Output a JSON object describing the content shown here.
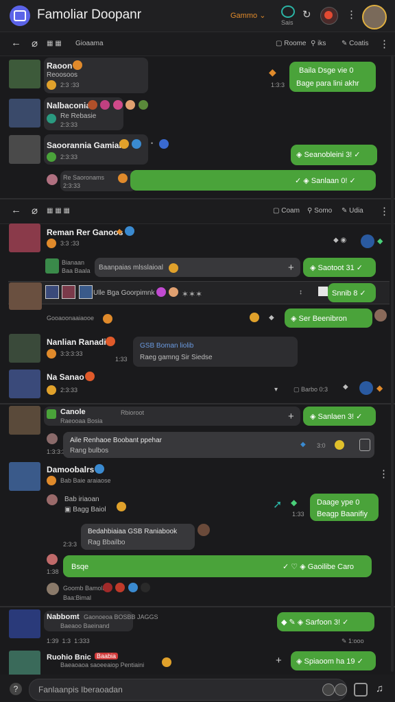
{
  "app": {
    "title": "Famoliar Doopanr",
    "account_label": "Gammo",
    "status_label": "Sais"
  },
  "subbar1": {
    "left_label": "Gioaama",
    "action1": "Roome",
    "action2": "iks",
    "action3": "Coatis"
  },
  "subbar2": {
    "action1": "Coam",
    "action2": "Somo",
    "action3": "Udia"
  },
  "messages": [
    {
      "name": "Raoon",
      "sub": "Reoosoos",
      "time": "2:3 :33",
      "right_time": "1:3:3",
      "reply_line1": "Baila Dsge vie 0",
      "reply_line2": "Bage para lini akhr"
    },
    {
      "name": "Nalbaconia",
      "sub": "Re Rebasie",
      "time": "2:3:33"
    },
    {
      "name": "Saoorannia Gamiak",
      "time": "2:3:33",
      "reply": "Seanobleini 3!",
      "bar_label": "Sanlaan 0!",
      "bar_sub": "Re Saoronams",
      "bar_time": "2:3:33"
    },
    {
      "name": "Reman Rer Ganoos",
      "time": "3:3 :33",
      "attach_label": "Bianaan",
      "attach_sub": "Baa Baala",
      "preview": "Baanpaias mlsslaioal",
      "reply": "Saotoot 31"
    },
    {
      "strip_text": "Ulle Bga Goorpimnk",
      "reply": "Snnib 8",
      "sub": "Gooaoonaaiaooe"
    },
    {
      "reply": "Ser Beenibron"
    },
    {
      "name": "Nanlian Ranadia",
      "time": "3:3:3:33",
      "mid_time": "1:33",
      "bubble_title": "GSB Boman liolib",
      "bubble_line": "Raeg gamng Sir Siedse"
    },
    {
      "name": "Na Sanao",
      "time": "2:3:33",
      "status": "Barbo 0:3"
    },
    {
      "name": "Canole",
      "sub": "Raeooaa Bosia",
      "right_note": "Rbioroot",
      "reply": "Sanlaen 3!"
    },
    {
      "line1": "Aile Renhaoe Boobant ppehar",
      "line2": "Rang bulbos",
      "time": "1:3:3:33",
      "badge": "3:0"
    },
    {
      "name": "Damoobalrs",
      "sub": "Bab Baie araiaose"
    },
    {
      "line1": "Bab iriaoan",
      "line2": "Bagg Baiol",
      "time": "1:33",
      "reply_line1": "Daage ype 0",
      "reply_line2": "Beagp Baanifiy"
    },
    {
      "line1": "Bedahbiaiaa GSB Raniabook",
      "line2": "Rag Bbailbo",
      "time": "2:3:3"
    },
    {
      "text": "Bsqe",
      "reply": "Gaoilibe Caro",
      "time": "1:38"
    },
    {
      "line1": "Goomb Bamolioo",
      "line2": "Baa:Bimal"
    },
    {
      "name": "Nabbomt",
      "sub_colored": "Gaonoeoa BOSBB JAGGS",
      "sub": "Baeaoo Baeinand",
      "reply": "Sarfoon 3!"
    },
    {
      "time1": "1:39",
      "time2": "1:3",
      "time3": "1:333",
      "right": "1:ooo"
    },
    {
      "name": "Ruohio Bnic",
      "badge": "Baabia",
      "sub": "Baeaoaoa saoeeaiop Pentiaini",
      "reply": "Spiaoom ha 19"
    }
  ],
  "composer": {
    "placeholder": "Fanlaanpis Iberaoadan"
  },
  "colors": {
    "accent_green": "#4aa33a",
    "brand": "#5b63e8",
    "warning": "#e08a2b"
  }
}
